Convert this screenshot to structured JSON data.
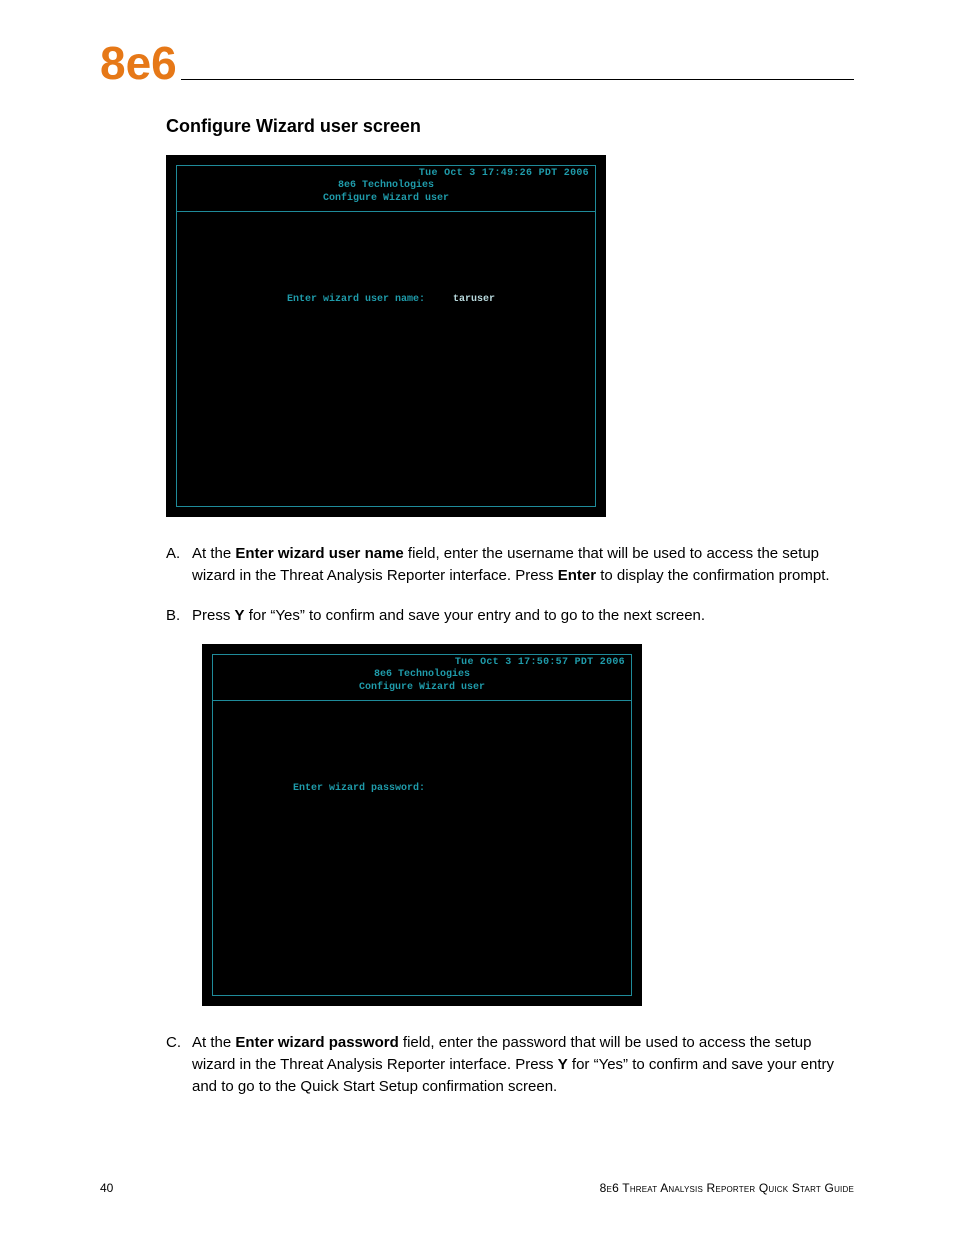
{
  "logo": "8e6",
  "heading": "Configure Wizard user screen",
  "terminal1": {
    "timestamp": "Tue Oct  3 17:49:26 PDT 2006",
    "title1": "8e6 Technologies",
    "title2": "Configure Wizard user",
    "prompt_label": "Enter wizard user name:",
    "prompt_value": "taruser"
  },
  "steps_ab": [
    {
      "letter": "A.",
      "pre": "At the ",
      "bold1": "Enter wizard user name",
      "mid1": " field, enter the username that will be used to access the setup wizard in the Threat Analysis Reporter interface. Press ",
      "bold2": "Enter",
      "post": " to display the confirmation prompt."
    },
    {
      "letter": "B.",
      "pre": "Press ",
      "bold1": "Y",
      "mid1": " for “Yes” to confirm and save your entry and to go to the next screen.",
      "bold2": "",
      "post": ""
    }
  ],
  "terminal2": {
    "timestamp": "Tue Oct  3 17:50:57 PDT 2006",
    "title1": "8e6 Technologies",
    "title2": "Configure Wizard user",
    "prompt_label": "Enter wizard password:",
    "prompt_value": ""
  },
  "steps_c": [
    {
      "letter": "C.",
      "pre": "At the ",
      "bold1": "Enter wizard password",
      "mid1": " field, enter the password that will be used to access the setup wizard in the Threat Analysis Reporter interface. Press ",
      "bold2": "Y",
      "post": " for “Yes” to confirm and save your entry and to go to the Quick Start Setup confirmation screen."
    }
  ],
  "footer": {
    "page": "40",
    "title_prefix": "8e6",
    "title_rest": " Threat Analysis Reporter Quick Start Guide"
  }
}
